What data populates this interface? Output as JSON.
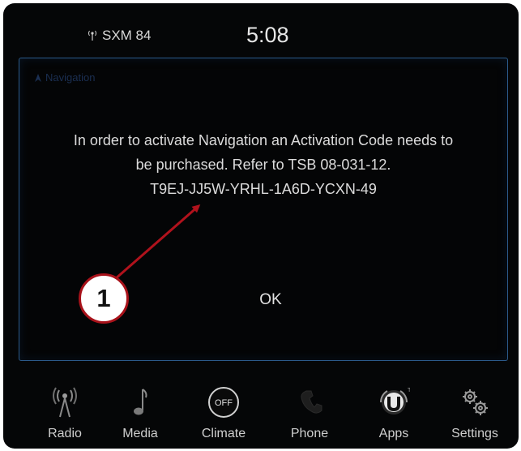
{
  "status_bar": {
    "radio_station": "SXM 84",
    "clock": "5:08"
  },
  "dialog": {
    "title": "Navigation",
    "message_line1": "In order to activate Navigation an Activation Code needs to",
    "message_line2": "be purchased. Refer to TSB 08-031-12.",
    "activation_code": "T9EJ-JJ5W-YRHL-1A6D-YCXN-49",
    "ok_label": "OK"
  },
  "callout": {
    "number": "1",
    "color": "#b0121c"
  },
  "nav_bar": {
    "items": [
      {
        "label": "Radio",
        "icon": "radio-antenna-icon"
      },
      {
        "label": "Media",
        "icon": "music-note-icon"
      },
      {
        "label": "Climate",
        "icon": "climate-off-icon",
        "badge": "OFF"
      },
      {
        "label": "Phone",
        "icon": "phone-icon"
      },
      {
        "label": "Apps",
        "icon": "uconnect-apps-icon"
      },
      {
        "label": "Settings",
        "icon": "gears-icon"
      }
    ]
  },
  "colors": {
    "screen_bg": "#050607",
    "dialog_border": "#2b5a8a",
    "text": "#dcdcdc"
  }
}
